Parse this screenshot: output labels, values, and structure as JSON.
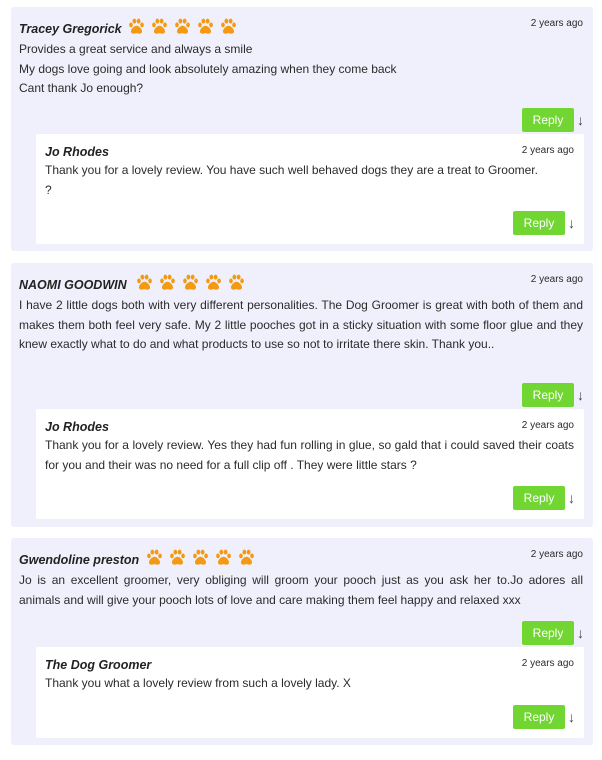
{
  "reviews": [
    {
      "author": "Tracey Gregorick",
      "rating": 5,
      "time": "2 years ago",
      "lines": [
        "Provides a great service and always a smile",
        "My dogs love going and look absolutely amazing when they come back",
        "Cant thank Jo enough?"
      ],
      "reply_label": "Reply",
      "response": {
        "author": "Jo Rhodes",
        "time": "2 years ago",
        "lines": [
          "Thank you for a lovely review. You have such well behaved dogs they are a treat to Groomer.",
          "?"
        ],
        "reply_label": "Reply"
      }
    },
    {
      "author": "NAOMI GOODWIN",
      "rating": 5,
      "time": "2 years ago",
      "text": "I have 2 little dogs both with very different personalities. The Dog Groomer is great with both of them and makes them both feel very safe. My 2 little pooches got in a sticky situation with some floor glue and they knew exactly what to do and what products to use so not to irritate there skin. Thank you..",
      "reply_label": "Reply",
      "response": {
        "author": "Jo Rhodes",
        "time": "2 years ago",
        "text": "Thank you for a lovely review. Yes they had fun rolling in glue, so gald that i could saved their coats for you and their was no need for a full clip off . They were little stars ?",
        "reply_label": "Reply"
      }
    },
    {
      "author": "Gwendoline preston",
      "rating": 5,
      "time": "2 years ago",
      "text": "Jo is an excellent groomer, very obliging will groom your pooch just as you ask her to.Jo adores all animals and will give your pooch lots of love and care making them feel happy and relaxed xxx",
      "reply_label": "Reply",
      "response": {
        "author": "The Dog Groomer",
        "time": "2 years ago",
        "text": "Thank you what a lovely review from such a lovely lady. X",
        "reply_label": "Reply"
      }
    }
  ],
  "icons": {
    "rating": "paw-icon",
    "expand": "arrow-down-icon"
  },
  "arrow_glyph": "↓",
  "colors": {
    "card_bg": "#f0f0fc",
    "reply_button": "#71d632",
    "paw": "#f39a12"
  }
}
